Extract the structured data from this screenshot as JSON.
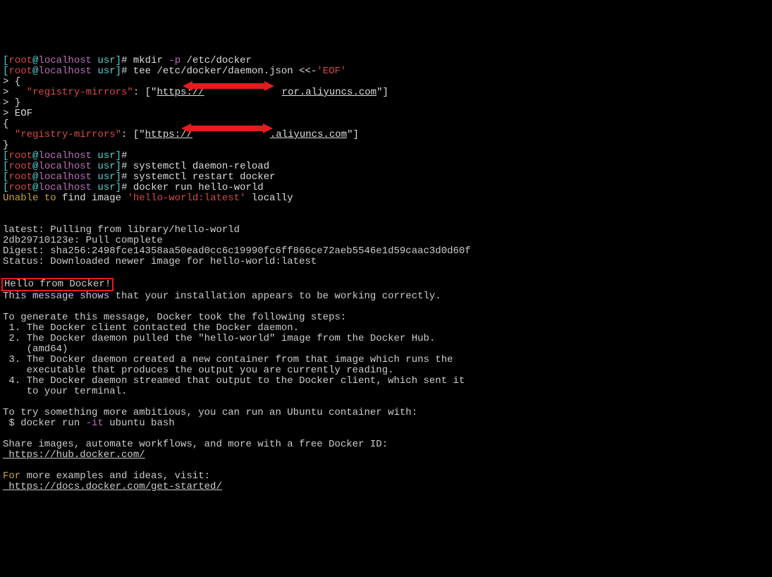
{
  "prompt": {
    "root": "root",
    "at": "@",
    "host": "localhost",
    "dir": " usr",
    "end": "]# "
  },
  "cmd": {
    "mkdir": "mkdir ",
    "mkdir_flag": "-p",
    "mkdir_arg": " /etc/docker",
    "tee": "tee /etc/docker/daemon.json <<-",
    "eof_q": "'EOF'",
    "heredoc1": "> {",
    "heredoc2a": ">   ",
    "reg_key": "\"registry-mirrors\"",
    "colon_arr": ": [\"",
    "url_left": "https://",
    "url_right1": "ror.aliyuncs.com",
    "url_right2": ".aliyuncs.com",
    "close_arr": "\"]",
    "heredoc3": "> }",
    "heredoc4": "> EOF",
    "out_open": "{",
    "out_key": "\"registry-mirrors\"",
    "out_close": "}",
    "empty": "",
    "sysreload": "systemctl daemon-reload",
    "sysrestart": "systemctl restart docker",
    "dockerrun": "docker run hello-world"
  },
  "unable": {
    "a": "Unable",
    "b": " to",
    "c": " find image ",
    "d": "'hello-world:latest'",
    "e": " locally"
  },
  "pull": {
    "l1": "latest: Pulling from library/hello-world",
    "l2": "2db29710123e: Pull complete",
    "l3": "Digest: sha256:2498fce14358aa50ead0cc6c19990fc6ff866ce72aeb5546e1d59caac3d0d60f",
    "l4": "Status: Downloaded newer image for hello-world:latest"
  },
  "hello": "Hello from Docker!",
  "msg": {
    "m1": "This message shows that your installation appears to be working correctly.",
    "g1": "To generate this message, Docker took the following steps:",
    "s1": " 1. The Docker client contacted the Docker daemon.",
    "s2": " 2. The Docker daemon pulled the \"hello-world\" image from the Docker Hub.",
    "s2b": "    (amd64)",
    "s3": " 3. The Docker daemon created a new container from that image which runs the",
    "s3b": "    executable that produces the output you are currently reading.",
    "s4": " 4. The Docker daemon streamed that output to the Docker client, which sent it",
    "s4b": "    to your terminal.",
    "t1": "To try something more ambitious, you can run an Ubuntu container with:",
    "t2a": " $ docker run ",
    "t2b": "-it",
    "t2c": " ubuntu bash",
    "sh1": "Share images, automate workflows, and more with a free Docker ID:",
    "hub": " https://hub.docker.com/",
    "f1a": "For",
    "f1b": " more examples and ideas, visit:",
    "docs": " https://docs.docker.com/get-started/"
  }
}
